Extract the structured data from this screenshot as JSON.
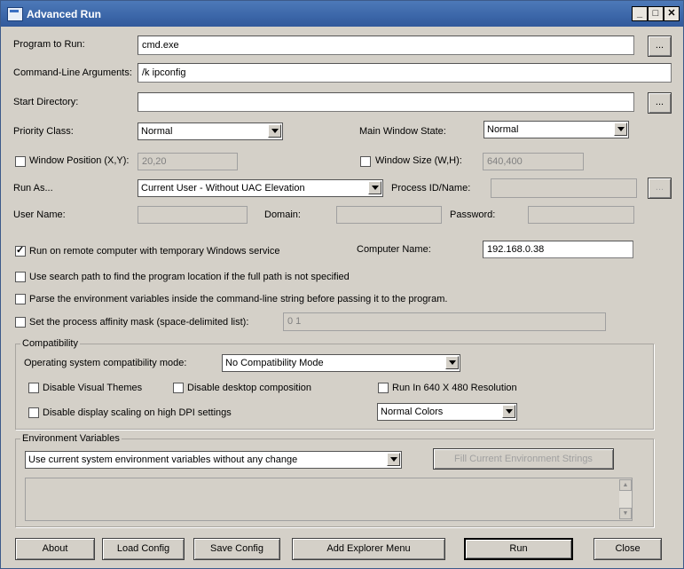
{
  "window": {
    "title": "Advanced Run"
  },
  "fields": {
    "program_label": "Program to Run:",
    "program_value": "cmd.exe",
    "args_label": "Command-Line Arguments:",
    "args_value": "/k ipconfig",
    "startdir_label": "Start Directory:",
    "startdir_value": "",
    "browse": "...",
    "priority_label": "Priority Class:",
    "priority_value": "Normal",
    "mainwin_label": "Main Window State:",
    "mainwin_value": "Normal",
    "winpos_label": "Window Position (X,Y):",
    "winpos_value": "20,20",
    "winsize_label": "Window Size (W,H):",
    "winsize_value": "640,400",
    "runas_label": "Run As...",
    "runas_value": "Current User - Without UAC Elevation",
    "pid_label": "Process ID/Name:",
    "username_label": "User Name:",
    "domain_label": "Domain:",
    "password_label": "Password:",
    "remote_label": "Run on remote computer with temporary Windows service",
    "computer_label": "Computer Name:",
    "computer_value": "192.168.0.38",
    "searchpath_label": "Use search path to find the program location if the full path is not specified",
    "parseenv_label": "Parse the environment variables inside the command-line string before passing it to the program.",
    "affinity_label": "Set the process affinity mask (space-delimited list):",
    "affinity_value": "0 1"
  },
  "compat": {
    "title": "Compatibility",
    "mode_label": "Operating system compatibility mode:",
    "mode_value": "No Compatibility Mode",
    "themes": "Disable Visual Themes",
    "desktop": "Disable desktop composition",
    "res640": "Run In 640 X 480 Resolution",
    "dpi": "Disable display scaling on high DPI settings",
    "colors_value": "Normal Colors"
  },
  "env": {
    "title": "Environment Variables",
    "mode_value": "Use current system environment variables without any change",
    "fill_button": "Fill Current Environment Strings"
  },
  "buttons": {
    "about": "About",
    "load": "Load Config",
    "save": "Save Config",
    "explorer": "Add Explorer Menu",
    "run": "Run",
    "close": "Close"
  },
  "checks": {
    "remote": true,
    "winpos": false,
    "winsize": false,
    "searchpath": false,
    "parseenv": false,
    "affinity": false,
    "themes": false,
    "desktop": false,
    "res640": false,
    "dpi": false
  }
}
